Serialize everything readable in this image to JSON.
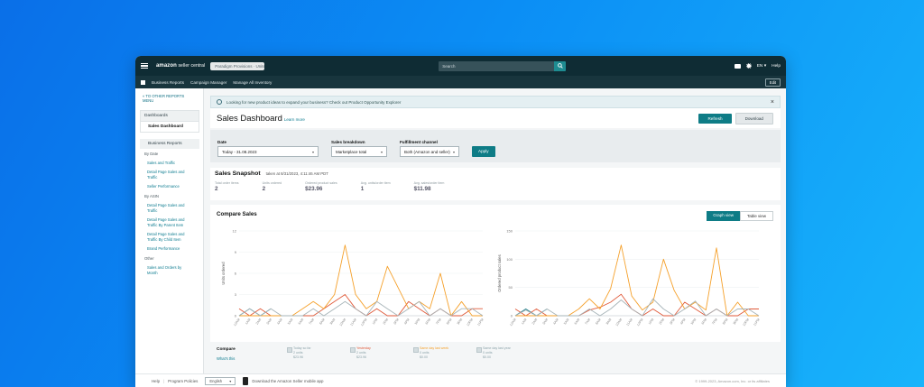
{
  "topbar": {
    "brand": "amazon",
    "brand_suffix": " seller central",
    "store": "Paradigm Provisions · United Sta",
    "search_placeholder": "Search",
    "lang": "EN ▾",
    "help": "Help"
  },
  "navbar": {
    "items": [
      "Business Reports",
      "Campaign Manager",
      "Manage All Inventory"
    ],
    "edit": "Edit"
  },
  "sidebar": {
    "back": "« TO OTHER REPORTS MENU",
    "dashboards": "Dashboards",
    "sales_dashboard": "Sales Dashboard",
    "business_reports": "Business Reports",
    "by_date": "By Date",
    "date_links": [
      "Sales and Traffic",
      "Detail Page Sales and Traffic",
      "Seller Performance"
    ],
    "by_asin": "By ASIN",
    "asin_links": [
      "Detail Page Sales and Traffic",
      "Detail Page Sales and Traffic By Parent Item",
      "Detail Page Sales and Traffic By Child Item",
      "Brand Performance"
    ],
    "other": "Other",
    "other_links": [
      "Sales and Orders by Month"
    ]
  },
  "alert": {
    "text": "Looking for new product ideas to expand your business? Check out Product Opportunity Explorer"
  },
  "header": {
    "title": "Sales Dashboard",
    "learn_more": "Learn more",
    "refresh": "Refresh",
    "download": "Download"
  },
  "filters": {
    "date_label": "Date",
    "date_value": "Today - 31.08.2023",
    "breakdown_label": "Sales breakdown",
    "breakdown_value": "Marketplace total",
    "channel_label": "Fulfillment channel",
    "channel_value": "Both (Amazon and seller)",
    "apply": "Apply"
  },
  "snapshot": {
    "title": "Sales Snapshot",
    "taken": "taken at 8/31/2023, 4:11:46 AM PDT",
    "metrics": [
      {
        "label": "Total order items",
        "value": "2"
      },
      {
        "label": "Units ordered",
        "value": "2"
      },
      {
        "label": "Ordered product sales",
        "value": "$23.96"
      },
      {
        "label": "Avg. units/order item",
        "value": "1"
      },
      {
        "label": "Avg. sales/order item",
        "value": "$11.98"
      }
    ]
  },
  "compare": {
    "title": "Compare Sales",
    "graph_view": "Graph view",
    "table_view": "Table view",
    "footer_title": "Compare",
    "footer_link": "What's this",
    "legend": [
      {
        "l1": "Today so far",
        "l2": "2 units",
        "l3": "$23.96",
        "color": "#8fb2bb"
      },
      {
        "l1": "Yesterday",
        "l2": "2 units",
        "l3": "$23.96",
        "color": "#e05a3a"
      },
      {
        "l1": "Same day last week",
        "l2": "0 units",
        "l3": "$0.00",
        "color": "#f5a02a"
      },
      {
        "l1": "Same day last year",
        "l2": "0 units",
        "l3": "$0.00",
        "color": "#a7b4b8"
      }
    ]
  },
  "chart_data": [
    {
      "type": "line",
      "ylabel": "Units ordered",
      "ylim": [
        0,
        12
      ],
      "yticks": [
        "0",
        "3",
        "6",
        "9",
        "12"
      ],
      "categories": [
        "12AM",
        "1AM",
        "2AM",
        "3AM",
        "4AM",
        "5AM",
        "6AM",
        "7AM",
        "8AM",
        "9AM",
        "10AM",
        "11AM",
        "12PM",
        "1PM",
        "2PM",
        "3PM",
        "4PM",
        "5PM",
        "6PM",
        "7PM",
        "8PM",
        "9PM",
        "10PM",
        "11PM"
      ],
      "series": [
        {
          "color": "#1f7f8a",
          "values": [
            0,
            1,
            0,
            1,
            null,
            null,
            null,
            null,
            null,
            null,
            null,
            null,
            null,
            null,
            null,
            null,
            null,
            null,
            null,
            null,
            null,
            null,
            null,
            null
          ]
        },
        {
          "color": "#e05a3a",
          "values": [
            1,
            0,
            1,
            0,
            0,
            0,
            0,
            0,
            1,
            2,
            3,
            1,
            0,
            1,
            0,
            0,
            2,
            1,
            0,
            1,
            0,
            0,
            1,
            1
          ]
        },
        {
          "color": "#f5a02a",
          "values": [
            0,
            0,
            0,
            0,
            0,
            0,
            1,
            2,
            1,
            3,
            10,
            3,
            1,
            2,
            7,
            4,
            1,
            2,
            1,
            6,
            0,
            2,
            0,
            0
          ]
        },
        {
          "color": "#a7b4b8",
          "values": [
            0,
            1,
            0,
            1,
            0,
            0,
            0,
            1,
            0,
            1,
            2,
            1,
            0,
            2,
            1,
            0,
            1,
            2,
            0,
            1,
            0,
            1,
            1,
            0
          ]
        }
      ]
    },
    {
      "type": "line",
      "ylabel": "Ordered product sales",
      "ylim": [
        0,
        150
      ],
      "yticks": [
        "0",
        "50",
        "100",
        "150"
      ],
      "categories": [
        "12AM",
        "1AM",
        "2AM",
        "3AM",
        "4AM",
        "5AM",
        "6AM",
        "7AM",
        "8AM",
        "9AM",
        "10AM",
        "11AM",
        "12PM",
        "1PM",
        "2PM",
        "3PM",
        "4PM",
        "5PM",
        "6PM",
        "7PM",
        "8PM",
        "9PM",
        "10PM",
        "11PM"
      ],
      "series": [
        {
          "color": "#1f7f8a",
          "values": [
            0,
            12,
            0,
            12,
            null,
            null,
            null,
            null,
            null,
            null,
            null,
            null,
            null,
            null,
            null,
            null,
            null,
            null,
            null,
            null,
            null,
            null,
            null,
            null
          ]
        },
        {
          "color": "#e05a3a",
          "values": [
            12,
            0,
            12,
            0,
            0,
            0,
            0,
            10,
            15,
            24,
            38,
            12,
            0,
            12,
            0,
            0,
            24,
            12,
            0,
            12,
            0,
            0,
            12,
            12
          ]
        },
        {
          "color": "#f5a02a",
          "values": [
            0,
            0,
            0,
            0,
            0,
            0,
            12,
            30,
            12,
            48,
            125,
            35,
            10,
            24,
            100,
            45,
            12,
            24,
            10,
            120,
            0,
            24,
            0,
            0
          ]
        },
        {
          "color": "#a7b4b8",
          "values": [
            0,
            10,
            0,
            12,
            0,
            0,
            0,
            12,
            0,
            12,
            28,
            12,
            0,
            30,
            12,
            0,
            12,
            26,
            0,
            12,
            0,
            12,
            12,
            0
          ]
        }
      ]
    }
  ],
  "footer": {
    "help": "Help",
    "policies": "Program Policies",
    "language": "English",
    "app": "Download the Amazon Seller mobile app",
    "copyright": "© 1999-2023, Amazon.com, Inc. or its affiliates"
  }
}
